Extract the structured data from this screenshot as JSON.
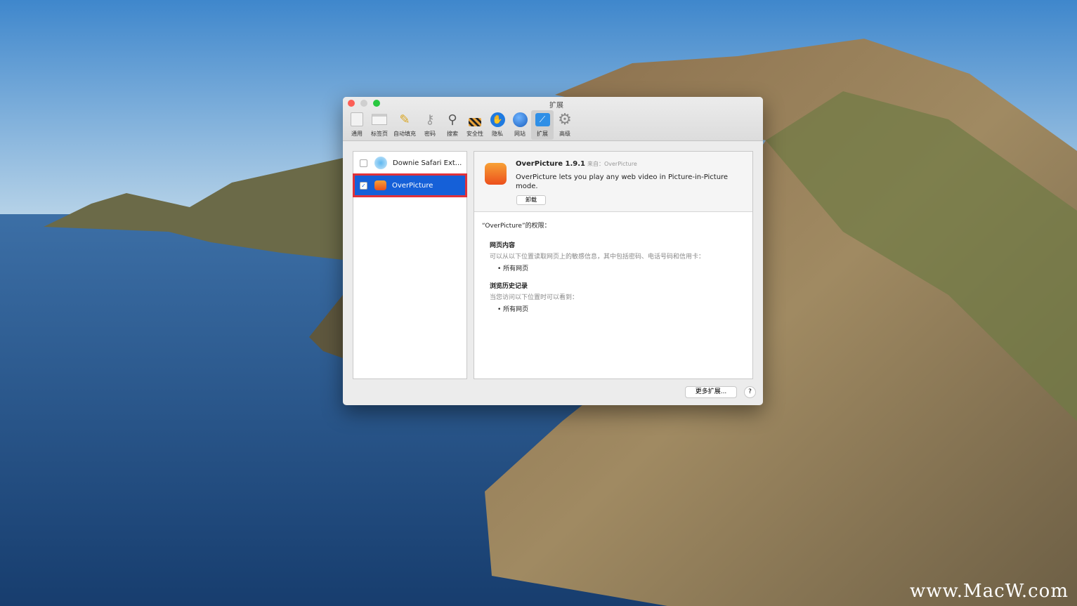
{
  "window": {
    "title": "扩展"
  },
  "toolbar": [
    {
      "label": "通用",
      "icon": "switch-icon"
    },
    {
      "label": "标签页",
      "icon": "tabs-icon"
    },
    {
      "label": "自动填充",
      "icon": "pencil-icon"
    },
    {
      "label": "密码",
      "icon": "key-icon"
    },
    {
      "label": "搜索",
      "icon": "search-icon"
    },
    {
      "label": "安全性",
      "icon": "lock-icon"
    },
    {
      "label": "隐私",
      "icon": "hand-icon"
    },
    {
      "label": "网站",
      "icon": "globe-icon"
    },
    {
      "label": "扩展",
      "icon": "extension-icon",
      "selected": true
    },
    {
      "label": "高级",
      "icon": "gear-icon"
    }
  ],
  "extensions": [
    {
      "name": "Downie Safari Ext...",
      "checked": false
    },
    {
      "name": "OverPicture",
      "checked": true,
      "selected": true
    }
  ],
  "detail": {
    "name": "OverPicture 1.9.1",
    "from": "来自：OverPicture",
    "description": "OverPicture lets you play any web video in Picture-in-Picture mode.",
    "uninstall": "卸载",
    "perm_title": "“OverPicture”的权限：",
    "sections": [
      {
        "heading": "网页内容",
        "desc": "可以从以下位置读取网页上的敏感信息，其中包括密码、电话号码和信用卡：",
        "bullet": "所有网页"
      },
      {
        "heading": "浏览历史记录",
        "desc": "当您访问以下位置时可以看到：",
        "bullet": "所有网页"
      }
    ]
  },
  "footer": {
    "more": "更多扩展...",
    "help": "?"
  },
  "watermark": "www.MacW.com"
}
